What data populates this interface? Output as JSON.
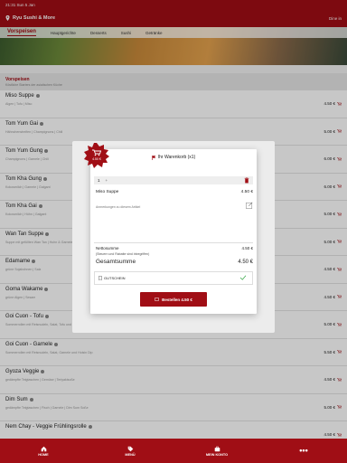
{
  "status_bar": {
    "time": "21:31",
    "date": "Sun 5 Jan",
    "right": ""
  },
  "header": {
    "brand": "Ryu Sushi & More",
    "signin": "Dine in"
  },
  "hero": {
    "tabs": [
      {
        "label": "Vorspeisen",
        "active": true
      },
      {
        "label": "Hauptgerichte",
        "active": false
      },
      {
        "label": "Desserts",
        "active": false
      },
      {
        "label": "Sushi",
        "active": false
      },
      {
        "label": "Getränke",
        "active": false
      }
    ]
  },
  "section": {
    "title": "Vorspeisen",
    "subtitle": "Köstliche Starters der asiatischen Küche"
  },
  "items": [
    {
      "name": "Miso Suppe",
      "desc": "Algen | Tofu | Miso",
      "price": "4.50 €"
    },
    {
      "name": "Tom Yum Gai",
      "desc": "Hähnchenstreifen | Champignons | Chili",
      "price": "5.00 €"
    },
    {
      "name": "Tom Yum Gung",
      "desc": "Champignons | Garnele | Chili",
      "price": "6.00 €"
    },
    {
      "name": "Tom Kha Gung",
      "desc": "Kokosmilch | Garnele | Galgant",
      "price": "6.00 €"
    },
    {
      "name": "Tom Kha Gai",
      "desc": "Kokosmilch | Hühn | Galgant",
      "price": "5.00 €"
    },
    {
      "name": "Wan Tan Suppe",
      "desc": "Suppe mit gefüllten Wan Tan | Huhn & Garnele",
      "price": "5.00 €"
    },
    {
      "name": "Edamame",
      "desc": "grüne Sojabohnen | Salz",
      "price": "4.50 €"
    },
    {
      "name": "Goma Wakame",
      "desc": "grüne Algen | Sesam",
      "price": "4.50 €"
    },
    {
      "name": "Goi Cuon - Tofu",
      "desc": "Sommerrollen mit Reisnudeln, Salat, Tofu und Hoisin Dip",
      "price": "5.00 €"
    },
    {
      "name": "Goi Cuon - Garnele",
      "desc": "Sommerrollen mit Reisnudeln, Salat, Garnele und Hoisin Dip",
      "price": "5.50 €"
    },
    {
      "name": "Gyoza Veggie",
      "desc": "gedämpfte Teigtaschen | Gemüse | Teriyakisoße",
      "price": "4.50 €"
    },
    {
      "name": "Dim Sum",
      "desc": "gedämpfte Teigtaschen | Fisch | Garnele | Dim Sum Soße",
      "price": "5.00 €"
    },
    {
      "name": "Nem Chay - Veggie Frühlingsrolle",
      "desc": "",
      "price": "4.50 €"
    }
  ],
  "cart": {
    "badge_price": "4.50 €",
    "title": "Ihr Warenkorb (x1)",
    "qty": "1",
    "qty_plus": "+",
    "line_name": "Miso Suppe",
    "line_price": "4.50 €",
    "note_placeholder": "Anmerkungen zu diesem Artikel",
    "netto_label": "Nettosumme",
    "netto_value": "4.50 €",
    "netto_note": "(Steuern und Rabatte sind inbegriffen)",
    "total_label": "Gesamtsumme",
    "total_value": "4.50 €",
    "voucher_label": "GUTSCHEIN",
    "order_button": "Bestellen 4.50 €"
  },
  "bottom_nav": [
    {
      "label": "HOME",
      "icon": "home-icon"
    },
    {
      "label": "MENÜ",
      "icon": "tag-icon"
    },
    {
      "label": "MEIN KONTO",
      "icon": "account-icon"
    },
    {
      "label": "•••",
      "icon": "more-icon"
    }
  ],
  "colors": {
    "brand": "#a00e15",
    "background": "#f2f2f2"
  }
}
